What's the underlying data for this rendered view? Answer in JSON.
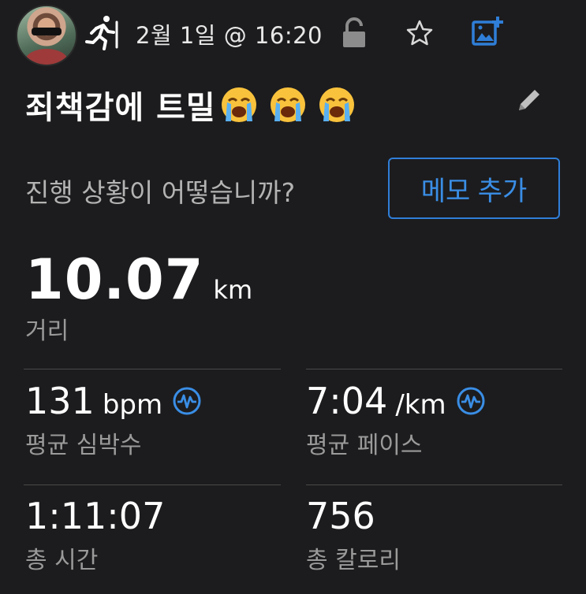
{
  "header": {
    "date_time": "2월 1일 @ 16:20",
    "icons": [
      "avatar",
      "running-icon",
      "unlock-icon",
      "star-icon",
      "add-photo-icon"
    ]
  },
  "activity": {
    "title": "죄책감에 트밀",
    "title_emojis": [
      "loudly-crying-face",
      "loudly-crying-face",
      "loudly-crying-face"
    ]
  },
  "prompt": {
    "question": "진행 상황이 어떻습니까?",
    "memo_button": "메모 추가"
  },
  "distance": {
    "value": "10.07",
    "unit": "km",
    "label": "거리"
  },
  "stats": {
    "heart_rate": {
      "value": "131",
      "unit": "bpm",
      "label": "평균 심박수",
      "icon": "heart-rate-icon"
    },
    "pace": {
      "value": "7:04",
      "unit": "/km",
      "label": "평균 페이스",
      "icon": "heart-rate-icon"
    },
    "time": {
      "value": "1:11:07",
      "label": "총 시간"
    },
    "calories": {
      "value": "756",
      "label": "총 칼로리"
    }
  },
  "colors": {
    "background": "#1c1c1e",
    "accent": "#2f7ed8",
    "label": "#9a9a9a",
    "divider": "#4a4a4a"
  }
}
